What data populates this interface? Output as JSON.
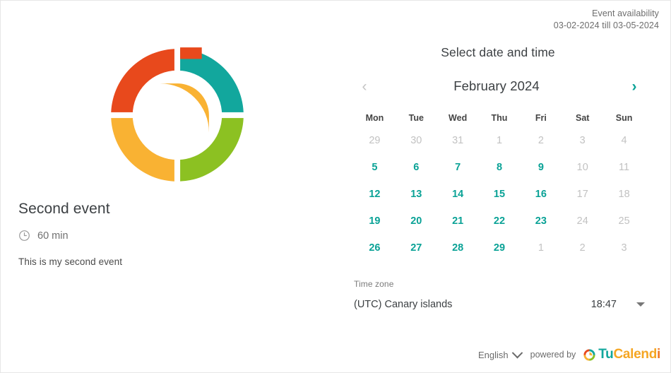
{
  "header": {
    "availability_label": "Event availability",
    "availability_range": "03-02-2024 till 03-05-2024"
  },
  "event": {
    "logo_icon": "tucalendi-donut-clock-logo",
    "title": "Second event",
    "duration_icon": "clock-icon",
    "duration": "60 min",
    "description": "This is my second event"
  },
  "scheduler": {
    "title": "Select date and time",
    "prev_month_icon": "chevron-left-icon",
    "next_month_icon": "chevron-right-icon",
    "month_label": "February 2024",
    "weekdays": [
      "Mon",
      "Tue",
      "Wed",
      "Thu",
      "Fri",
      "Sat",
      "Sun"
    ],
    "days": [
      {
        "label": "29",
        "state": "dim"
      },
      {
        "label": "30",
        "state": "dim"
      },
      {
        "label": "31",
        "state": "dim"
      },
      {
        "label": "1",
        "state": "dim"
      },
      {
        "label": "2",
        "state": "dim"
      },
      {
        "label": "3",
        "state": "dim"
      },
      {
        "label": "4",
        "state": "dim"
      },
      {
        "label": "5",
        "state": "avail"
      },
      {
        "label": "6",
        "state": "avail"
      },
      {
        "label": "7",
        "state": "avail"
      },
      {
        "label": "8",
        "state": "avail"
      },
      {
        "label": "9",
        "state": "avail"
      },
      {
        "label": "10",
        "state": "dim"
      },
      {
        "label": "11",
        "state": "dim"
      },
      {
        "label": "12",
        "state": "avail"
      },
      {
        "label": "13",
        "state": "avail"
      },
      {
        "label": "14",
        "state": "avail"
      },
      {
        "label": "15",
        "state": "avail"
      },
      {
        "label": "16",
        "state": "avail"
      },
      {
        "label": "17",
        "state": "dim"
      },
      {
        "label": "18",
        "state": "dim"
      },
      {
        "label": "19",
        "state": "avail"
      },
      {
        "label": "20",
        "state": "avail"
      },
      {
        "label": "21",
        "state": "avail"
      },
      {
        "label": "22",
        "state": "avail"
      },
      {
        "label": "23",
        "state": "avail"
      },
      {
        "label": "24",
        "state": "dim"
      },
      {
        "label": "25",
        "state": "dim"
      },
      {
        "label": "26",
        "state": "avail"
      },
      {
        "label": "27",
        "state": "avail"
      },
      {
        "label": "28",
        "state": "avail"
      },
      {
        "label": "29",
        "state": "avail"
      },
      {
        "label": "1",
        "state": "dim"
      },
      {
        "label": "2",
        "state": "dim"
      },
      {
        "label": "3",
        "state": "dim"
      }
    ]
  },
  "timezone": {
    "label": "Time zone",
    "value": "(UTC) Canary islands",
    "time": "18:47",
    "caret_icon": "caret-down-icon"
  },
  "footer": {
    "language": "English",
    "language_caret_icon": "chevron-down-icon",
    "powered_by": "powered by",
    "brand_mark_icon": "tucalendi-mark-icon",
    "brand_tu": "Tu",
    "brand_calend": "Calend",
    "brand_i": "i"
  },
  "colors": {
    "accent_teal": "#0aa296",
    "logo_teal": "#12a79d",
    "logo_green": "#8cc122",
    "logo_amber": "#f9b233",
    "logo_red": "#e8491c",
    "brand_orange": "#f5a623",
    "text_dark": "#3c4043",
    "text_muted": "#6d6d6d",
    "text_disabled": "#c2c2c2",
    "card_border": "#e6e6e6"
  }
}
